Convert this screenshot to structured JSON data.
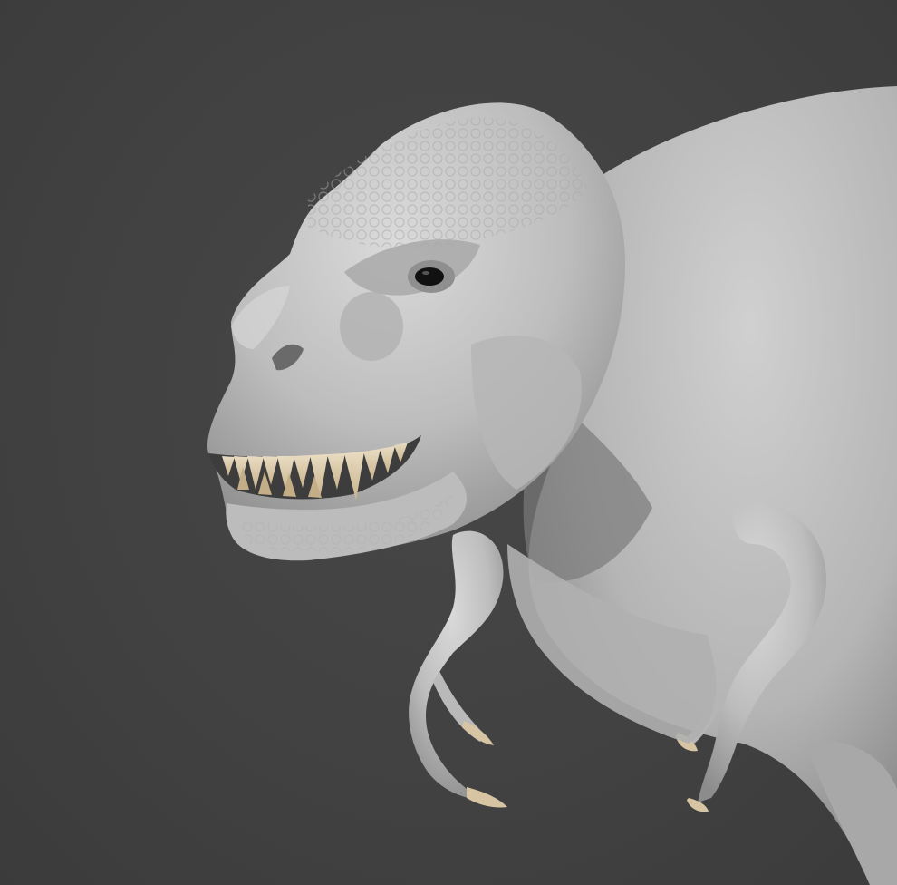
{
  "scene": {
    "subject": "dinosaur-sculpt",
    "background_color": "#414141",
    "clay_color": "#c9c9c9",
    "teeth_color": "#d9c7a6",
    "claw_color": "#d6c4a3"
  }
}
